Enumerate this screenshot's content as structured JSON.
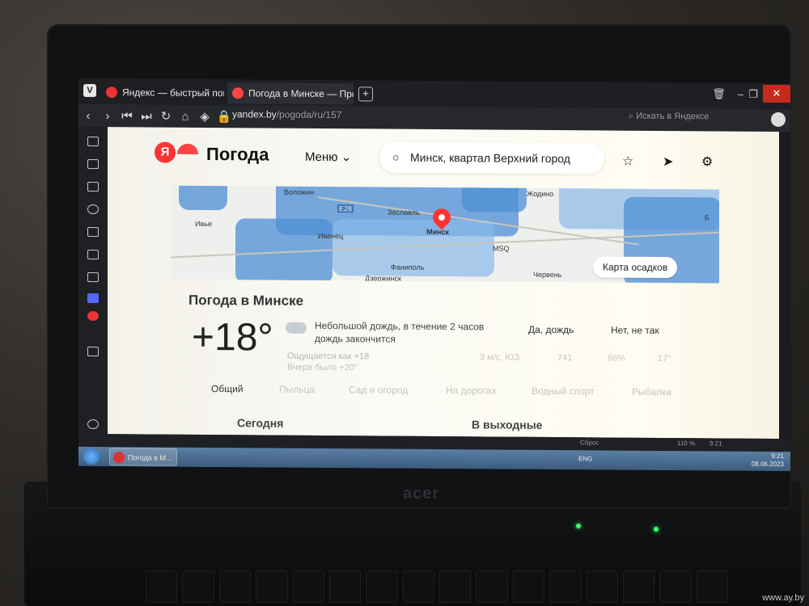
{
  "photo": {
    "brand": "acer",
    "watermark": "www.ay.by"
  },
  "browser": {
    "app_icon": "V",
    "tabs": [
      {
        "label": "Яндекс — быстрый поиск",
        "favicon": "yandex-icon",
        "active": false
      },
      {
        "label": "Погода в Минске — Прогноз",
        "favicon": "yandex-weather-icon",
        "active": true
      }
    ],
    "new_tab": "+",
    "address_host": "yandex.by",
    "address_path": "/pogoda/ru/157",
    "search_placeholder": "Искать в Яндексе",
    "accent_close": "#c42b1c"
  },
  "weather": {
    "logo_letter": "Я",
    "logo_text": "Погода",
    "menu_label": "Меню",
    "city_search": "Минск, квартал Верхний город",
    "map": {
      "labels": [
        "Воложин",
        "Жодино",
        "Ивье",
        "Заславль",
        "Минск",
        "Ивенец",
        "MSQ",
        "Фаниполь",
        "Червень",
        "Дзержинск",
        "Б",
        "E28"
      ],
      "button": "Карта осадков"
    },
    "title": "Погода в Минске",
    "temperature": "+18°",
    "condition": "Небольшой дождь, в течение 2 часов дождь закончится",
    "poll_yes": "Да, дождь",
    "poll_no": "Нет, не так",
    "feels_like": "Ощущается как +18",
    "yesterday": "Вчера было +20°",
    "params": [
      "3 м/с, ЮЗ",
      "741",
      "86%",
      "17°"
    ],
    "subtabs": [
      "Общий",
      "Пыльца",
      "Сад и огород",
      "На дорогах",
      "Водный спорт",
      "Рыбалка"
    ],
    "sections": [
      "Сегодня",
      "В выходные"
    ]
  },
  "statusbar": {
    "reset": "Сброс",
    "zoom": "110 %",
    "time": "9:21"
  },
  "taskbar": {
    "task_label": "Погода в М...",
    "lang": "ENG",
    "time": "9:21",
    "date": "08.06.2023"
  }
}
